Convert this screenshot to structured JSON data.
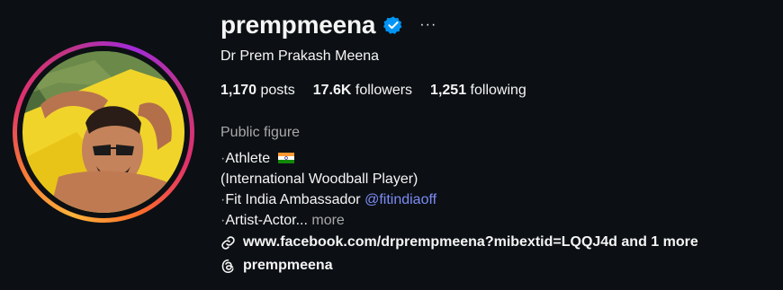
{
  "profile": {
    "username": "prempmeena",
    "full_name": "Dr Prem Prakash Meena",
    "verified": true,
    "options_label": "···"
  },
  "stats": {
    "posts": {
      "count": "1,170",
      "label": "posts"
    },
    "followers": {
      "count": "17.6K",
      "label": "followers"
    },
    "following": {
      "count": "1,251",
      "label": "following"
    }
  },
  "bio": {
    "category": "Public figure",
    "bullet": "·",
    "line1": "Athlete",
    "line2": "(International Woodball Player)",
    "line3": "Fit India Ambassador",
    "line3_mention": "@fitindiaoff",
    "line4": "Artist-Actor...",
    "more_label": "more"
  },
  "links": {
    "url": "www.facebook.com/drprempmeena?mibextid=LQQJ4d and 1 more",
    "threads_handle": "prempmeena"
  },
  "colors": {
    "background": "#0c1014",
    "text": "#f5f5f5",
    "secondary_text": "#a8a8a8",
    "mention": "#7d8cf5",
    "verified_badge": "#0095f6"
  },
  "icons": {
    "verified": "verified-badge-icon",
    "link": "link-icon",
    "threads": "threads-icon",
    "flag": "india-flag-emoji"
  }
}
